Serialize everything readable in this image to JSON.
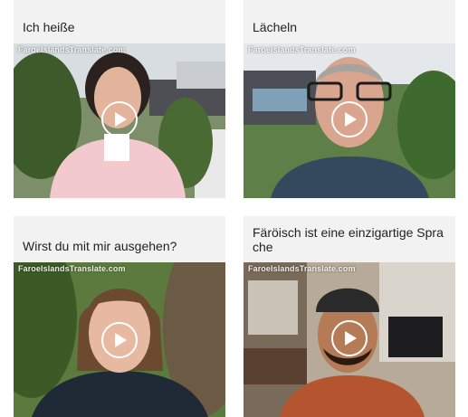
{
  "cards": [
    {
      "title": "Ich heiße",
      "watermark": "FaroeIslandsTranslate.com",
      "thumbnail": "woman-in-pink-blazer-selfie",
      "play_icon": "play-icon"
    },
    {
      "title": "Lächeln",
      "watermark": "FaroeIslandsTranslate.com",
      "thumbnail": "man-with-glasses-selfie",
      "play_icon": "play-icon"
    },
    {
      "title": "Wirst du mit mir ausgehen?",
      "watermark": "FaroeIslandsTranslate.com",
      "thumbnail": "young-woman-outdoors-selfie",
      "play_icon": "play-icon"
    },
    {
      "title_line1": "Färöisch ist eine einzigartige Spra",
      "title_line2": "che",
      "watermark": "FaroeIslandsTranslate.com",
      "thumbnail": "man-in-beanie-shop-selfie",
      "play_icon": "play-icon"
    }
  ],
  "colors": {
    "card_background": "#f2f2f2",
    "title_text": "#222222",
    "play_ring": "#ffffff"
  }
}
